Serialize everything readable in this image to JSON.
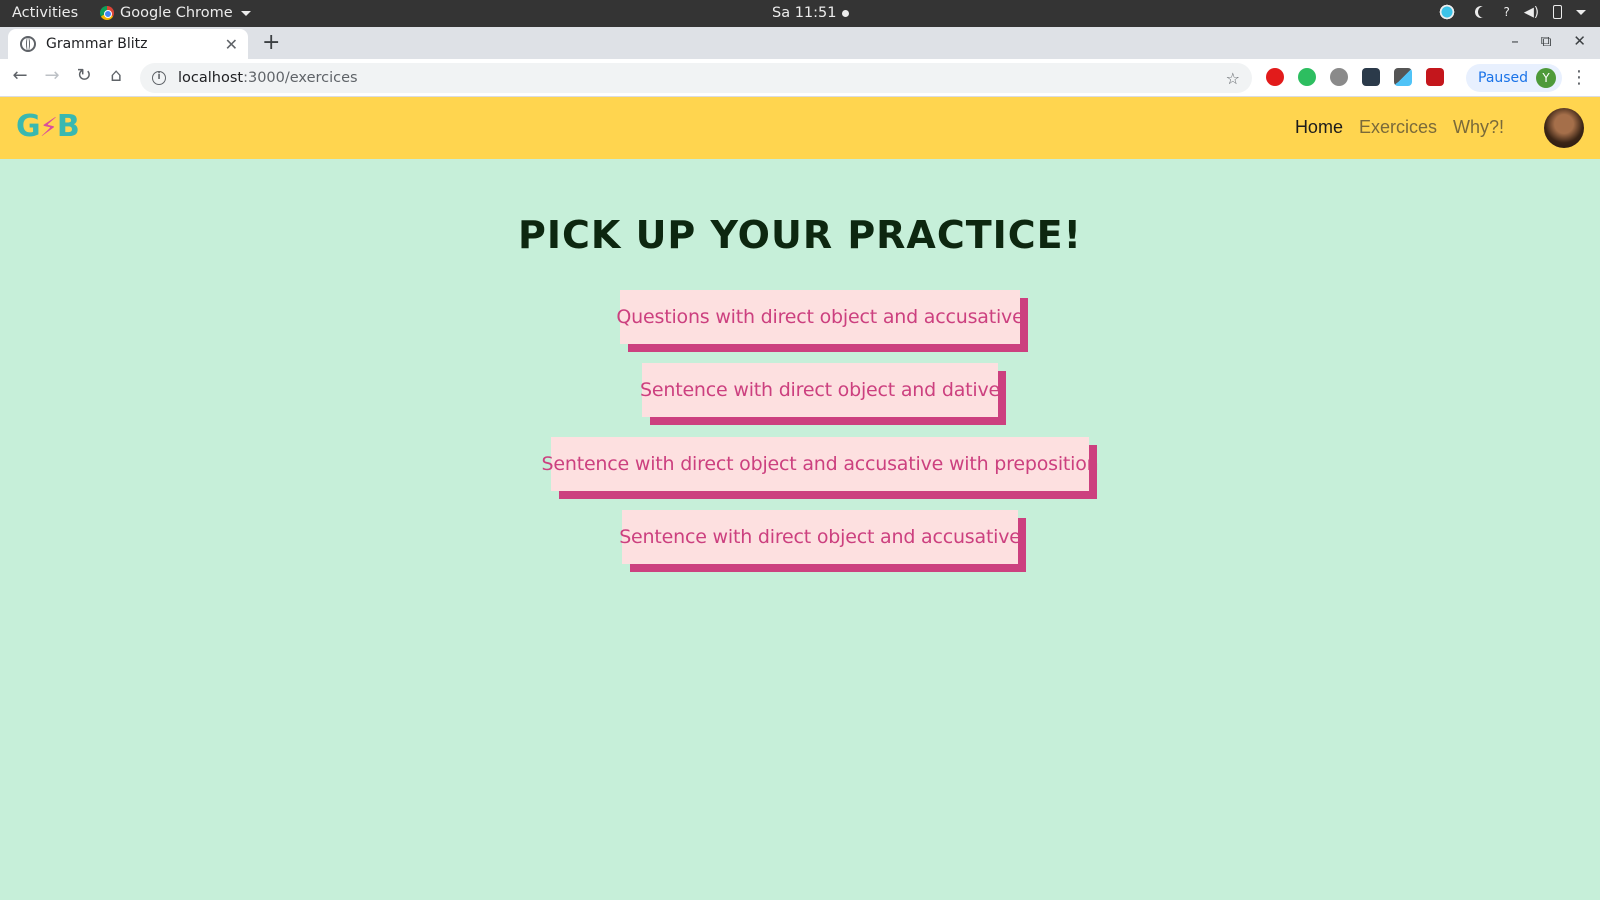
{
  "os_bar": {
    "activities": "Activities",
    "app_name": "Google Chrome",
    "clock": "Sa 11:51"
  },
  "browser": {
    "tab_title": "Grammar Blitz",
    "url_host": "localhost",
    "url_path": ":3000/exercices",
    "profile_status": "Paused",
    "profile_initial": "Y"
  },
  "nav": {
    "logo_g": "G",
    "logo_bolt": "⚡",
    "logo_b": "B",
    "links": [
      "Home",
      "Exercices",
      "Why?!"
    ]
  },
  "main": {
    "title": "Pick up your practice!",
    "exercises": [
      "Questions with direct object and accusative",
      "Sentence with direct object and dative",
      "Sentence with direct object and accusative with preposition",
      "Sentence with direct object and accusative"
    ]
  },
  "colors": {
    "background": "#c6efd9",
    "navbar": "#ffd54f",
    "button_bg": "#fde0e0",
    "button_accent": "#cc407f",
    "title": "#0d2710"
  }
}
